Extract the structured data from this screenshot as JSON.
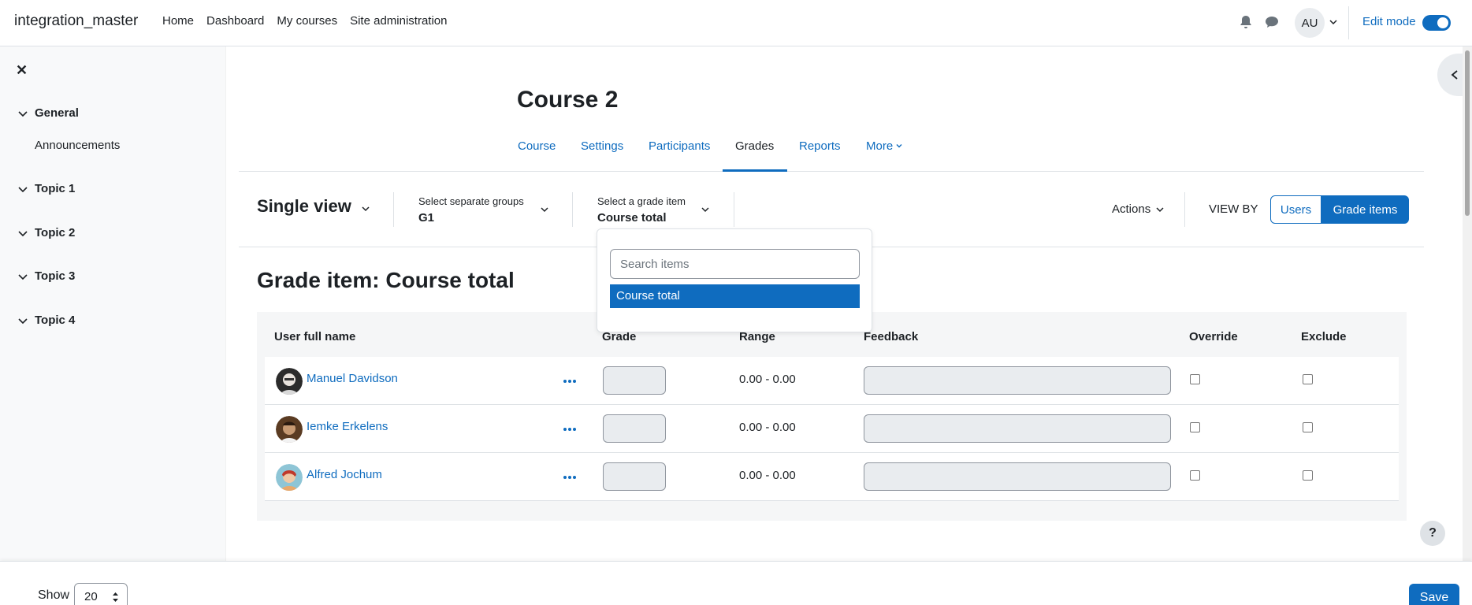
{
  "navbar": {
    "brand": "integration_master",
    "links": [
      "Home",
      "Dashboard",
      "My courses",
      "Site administration"
    ],
    "user_initials": "AU",
    "edit_mode_label": "Edit mode"
  },
  "drawer": {
    "sections": [
      {
        "label": "General",
        "items": [
          "Announcements"
        ]
      },
      {
        "label": "Topic 1",
        "items": []
      },
      {
        "label": "Topic 2",
        "items": []
      },
      {
        "label": "Topic 3",
        "items": []
      },
      {
        "label": "Topic 4",
        "items": []
      }
    ]
  },
  "page": {
    "title": "Course 2",
    "tabs": [
      "Course",
      "Settings",
      "Participants",
      "Grades",
      "Reports",
      "More"
    ],
    "active_tab": "Grades"
  },
  "grader": {
    "view_name": "Single view",
    "group_label": "Select separate groups",
    "group_value": "G1",
    "grade_item_label": "Select a grade item",
    "grade_item_value": "Course total",
    "actions_label": "Actions",
    "view_by_label": "VIEW BY",
    "view_by_users": "Users",
    "view_by_grade_items": "Grade items"
  },
  "dropdown": {
    "search_placeholder": "Search items",
    "items": [
      "Course total"
    ]
  },
  "heading": "Grade item: Course total",
  "table": {
    "headers": [
      "User full name",
      "Grade",
      "Range",
      "Feedback",
      "Override",
      "Exclude"
    ],
    "rows": [
      {
        "name": "Manuel Davidson",
        "range": "0.00 - 0.00"
      },
      {
        "name": "Iemke Erkelens",
        "range": "0.00 - 0.00"
      },
      {
        "name": "Alfred Jochum",
        "range": "0.00 - 0.00"
      }
    ]
  },
  "footer": {
    "show_label": "Show",
    "show_value": "20",
    "save_label": "Save"
  },
  "help_label": "?",
  "colors": {
    "accent": "#0f6cbf",
    "text": "#1d2125",
    "drawer_bg": "#f8f9fa"
  }
}
